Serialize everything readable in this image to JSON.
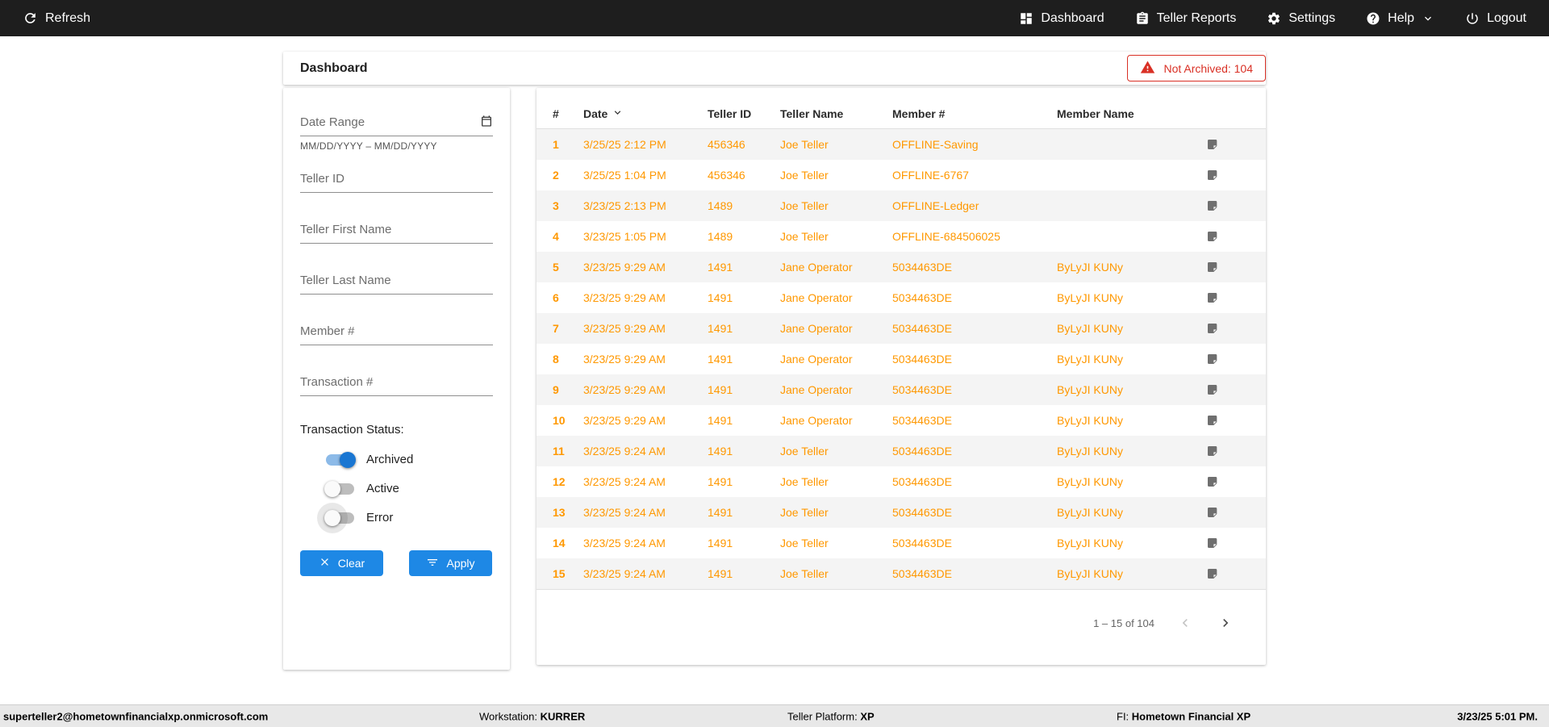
{
  "colors": {
    "navbar_bg": "#1e1e1e",
    "accent_blue": "#1e88e5",
    "toggle_on_blue": "#1976d2",
    "row_orange": "#ff9800",
    "alert_red": "#d93025",
    "footer_bg": "#e8e8e8"
  },
  "navbar": {
    "refresh_label": "Refresh",
    "items": [
      {
        "label": "Dashboard"
      },
      {
        "label": "Teller Reports"
      },
      {
        "label": "Settings"
      },
      {
        "label": "Help"
      },
      {
        "label": "Logout"
      }
    ]
  },
  "header": {
    "title": "Dashboard",
    "not_archived_badge": "Not Archived: 104"
  },
  "filters": {
    "date_range": {
      "placeholder": "Date Range",
      "hint": "MM/DD/YYYY – MM/DD/YYYY"
    },
    "fields": [
      {
        "placeholder": "Teller ID"
      },
      {
        "placeholder": "Teller First Name"
      },
      {
        "placeholder": "Teller Last Name"
      },
      {
        "placeholder": "Member #"
      },
      {
        "placeholder": "Transaction #"
      }
    ],
    "status_label": "Transaction Status:",
    "toggles": [
      {
        "label": "Archived",
        "on": true
      },
      {
        "label": "Active",
        "on": false
      },
      {
        "label": "Error",
        "on": false,
        "focused": true
      }
    ],
    "clear_label": "Clear",
    "apply_label": "Apply"
  },
  "table": {
    "columns": [
      "#",
      "Date",
      "Teller ID",
      "Teller Name",
      "Member #",
      "Member Name"
    ],
    "sorted_column": "Date",
    "sort_direction": "desc",
    "rows": [
      {
        "num": "1",
        "date": "3/25/25 2:12 PM",
        "teller_id": "456346",
        "teller_name": "Joe Teller",
        "member_num": "OFFLINE-Saving",
        "member_name": ""
      },
      {
        "num": "2",
        "date": "3/25/25 1:04 PM",
        "teller_id": "456346",
        "teller_name": "Joe Teller",
        "member_num": "OFFLINE-6767",
        "member_name": ""
      },
      {
        "num": "3",
        "date": "3/23/25 2:13 PM",
        "teller_id": "1489",
        "teller_name": "Joe Teller",
        "member_num": "OFFLINE-Ledger",
        "member_name": ""
      },
      {
        "num": "4",
        "date": "3/23/25 1:05 PM",
        "teller_id": "1489",
        "teller_name": "Joe Teller",
        "member_num": "OFFLINE-684506025",
        "member_name": ""
      },
      {
        "num": "5",
        "date": "3/23/25 9:29 AM",
        "teller_id": "1491",
        "teller_name": "Jane Operator",
        "member_num": "5034463DE",
        "member_name": "ByLyJI KUNy"
      },
      {
        "num": "6",
        "date": "3/23/25 9:29 AM",
        "teller_id": "1491",
        "teller_name": "Jane Operator",
        "member_num": "5034463DE",
        "member_name": "ByLyJI KUNy"
      },
      {
        "num": "7",
        "date": "3/23/25 9:29 AM",
        "teller_id": "1491",
        "teller_name": "Jane Operator",
        "member_num": "5034463DE",
        "member_name": "ByLyJI KUNy"
      },
      {
        "num": "8",
        "date": "3/23/25 9:29 AM",
        "teller_id": "1491",
        "teller_name": "Jane Operator",
        "member_num": "5034463DE",
        "member_name": "ByLyJI KUNy"
      },
      {
        "num": "9",
        "date": "3/23/25 9:29 AM",
        "teller_id": "1491",
        "teller_name": "Jane Operator",
        "member_num": "5034463DE",
        "member_name": "ByLyJI KUNy"
      },
      {
        "num": "10",
        "date": "3/23/25 9:29 AM",
        "teller_id": "1491",
        "teller_name": "Jane Operator",
        "member_num": "5034463DE",
        "member_name": "ByLyJI KUNy"
      },
      {
        "num": "11",
        "date": "3/23/25 9:24 AM",
        "teller_id": "1491",
        "teller_name": "Joe Teller",
        "member_num": "5034463DE",
        "member_name": "ByLyJI KUNy"
      },
      {
        "num": "12",
        "date": "3/23/25 9:24 AM",
        "teller_id": "1491",
        "teller_name": "Joe Teller",
        "member_num": "5034463DE",
        "member_name": "ByLyJI KUNy"
      },
      {
        "num": "13",
        "date": "3/23/25 9:24 AM",
        "teller_id": "1491",
        "teller_name": "Joe Teller",
        "member_num": "5034463DE",
        "member_name": "ByLyJI KUNy"
      },
      {
        "num": "14",
        "date": "3/23/25 9:24 AM",
        "teller_id": "1491",
        "teller_name": "Joe Teller",
        "member_num": "5034463DE",
        "member_name": "ByLyJI KUNy"
      },
      {
        "num": "15",
        "date": "3/23/25 9:24 AM",
        "teller_id": "1491",
        "teller_name": "Joe Teller",
        "member_num": "5034463DE",
        "member_name": "ByLyJI KUNy"
      }
    ],
    "pagination": {
      "range_label": "1 – 15 of 104"
    }
  },
  "footer": {
    "email": "superteller2@hometownfinancialxp.onmicrosoft.com",
    "workstation_label": "Workstation:",
    "workstation_value": "KURRER",
    "platform_label": "Teller Platform:",
    "platform_value": "XP",
    "fi_label": "FI:",
    "fi_value": "Hometown Financial XP",
    "datetime": "3/23/25 5:01 PM."
  }
}
